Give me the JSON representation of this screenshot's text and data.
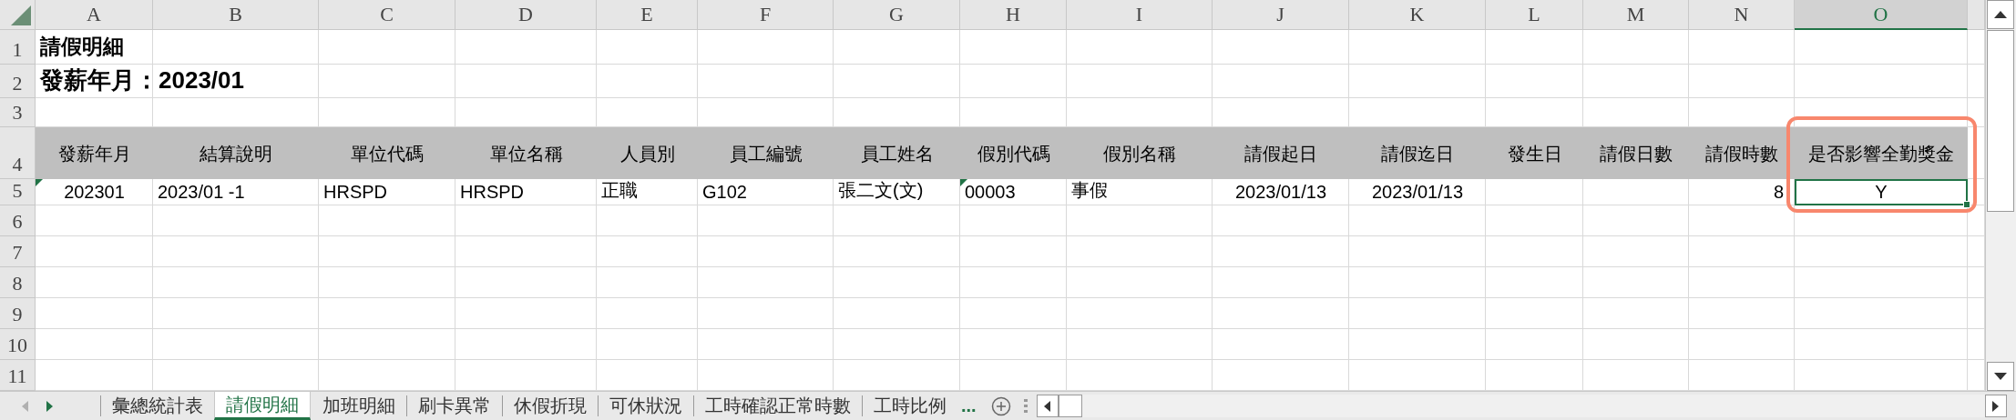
{
  "column_headers": [
    {
      "label": "A",
      "selected": false
    },
    {
      "label": "B",
      "selected": false
    },
    {
      "label": "C",
      "selected": false
    },
    {
      "label": "D",
      "selected": false
    },
    {
      "label": "E",
      "selected": false
    },
    {
      "label": "F",
      "selected": false
    },
    {
      "label": "G",
      "selected": false
    },
    {
      "label": "H",
      "selected": false
    },
    {
      "label": "I",
      "selected": false
    },
    {
      "label": "J",
      "selected": false
    },
    {
      "label": "K",
      "selected": false
    },
    {
      "label": "L",
      "selected": false
    },
    {
      "label": "M",
      "selected": false
    },
    {
      "label": "N",
      "selected": false
    },
    {
      "label": "O",
      "selected": true
    }
  ],
  "row_headers": [
    "1",
    "2",
    "3",
    "4",
    "5",
    "6",
    "7",
    "8",
    "9",
    "10",
    "11"
  ],
  "title": "請假明細",
  "pay_period": "發薪年月：2023/01",
  "table": {
    "columns": [
      {
        "label": "發薪年月",
        "highlighted": false
      },
      {
        "label": "結算說明",
        "highlighted": false
      },
      {
        "label": "單位代碼",
        "highlighted": false
      },
      {
        "label": "單位名稱",
        "highlighted": false
      },
      {
        "label": "人員別",
        "highlighted": false
      },
      {
        "label": "員工編號",
        "highlighted": false
      },
      {
        "label": "員工姓名",
        "highlighted": false
      },
      {
        "label": "假別代碼",
        "highlighted": false
      },
      {
        "label": "假別名稱",
        "highlighted": false
      },
      {
        "label": "請假起日",
        "highlighted": false
      },
      {
        "label": "請假迄日",
        "highlighted": false
      },
      {
        "label": "發生日",
        "highlighted": false
      },
      {
        "label": "請假日數",
        "highlighted": false
      },
      {
        "label": "請假時數",
        "highlighted": false
      },
      {
        "label": "是否影響全勤獎金",
        "highlighted": true
      }
    ],
    "rows": [
      {
        "cells": [
          {
            "text": "202301",
            "warning": true,
            "selected": false
          },
          {
            "text": "2023/01 -1",
            "warning": false,
            "selected": false
          },
          {
            "text": "HRSPD",
            "warning": false,
            "selected": false
          },
          {
            "text": "HRSPD",
            "warning": false,
            "selected": false
          },
          {
            "text": "正職",
            "warning": false,
            "selected": false
          },
          {
            "text": "G102",
            "warning": false,
            "selected": false
          },
          {
            "text": "張二文(文)",
            "warning": false,
            "selected": false
          },
          {
            "text": "00003",
            "warning": true,
            "selected": false
          },
          {
            "text": "事假",
            "warning": false,
            "selected": false
          },
          {
            "text": "2023/01/13",
            "warning": false,
            "selected": false
          },
          {
            "text": "2023/01/13",
            "warning": false,
            "selected": false
          },
          {
            "warning": false,
            "selected": false
          },
          {
            "warning": false,
            "selected": false
          },
          {
            "text": "8",
            "warning": false,
            "selected": false
          },
          {
            "text": "Y",
            "warning": false,
            "selected": true
          }
        ]
      }
    ]
  },
  "sheet_tabs": [
    {
      "label": "彙總統計表",
      "selected": false
    },
    {
      "label": "請假明細",
      "selected": true
    },
    {
      "label": "加班明細",
      "selected": false
    },
    {
      "label": "刷卡異常",
      "selected": false
    },
    {
      "label": "休假折現",
      "selected": false
    },
    {
      "label": "可休狀況",
      "selected": false
    },
    {
      "label": "工時確認正常時數",
      "selected": false
    },
    {
      "label": "工時比例",
      "selected": false
    }
  ],
  "more_tabs": "..."
}
